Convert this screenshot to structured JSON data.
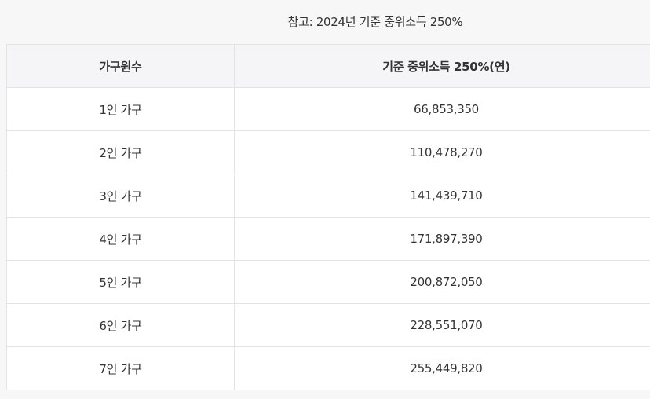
{
  "caption": "참고: 2024년 기준 중위소득 250%",
  "table": {
    "headers": [
      "가구원수",
      "기준 중위소득 250%(연)"
    ],
    "rows": [
      [
        "1인 가구",
        "66,853,350"
      ],
      [
        "2인 가구",
        "110,478,270"
      ],
      [
        "3인 가구",
        "141,439,710"
      ],
      [
        "4인 가구",
        "171,897,390"
      ],
      [
        "5인 가구",
        "200,872,050"
      ],
      [
        "6인 가구",
        "228,551,070"
      ],
      [
        "7인 가구",
        "255,449,820"
      ]
    ]
  },
  "colors": {
    "page_background": "#f7f7f7",
    "header_background": "#f5f5f7",
    "cell_background": "#ffffff",
    "border": "#e3e3e3",
    "text": "#333333"
  }
}
